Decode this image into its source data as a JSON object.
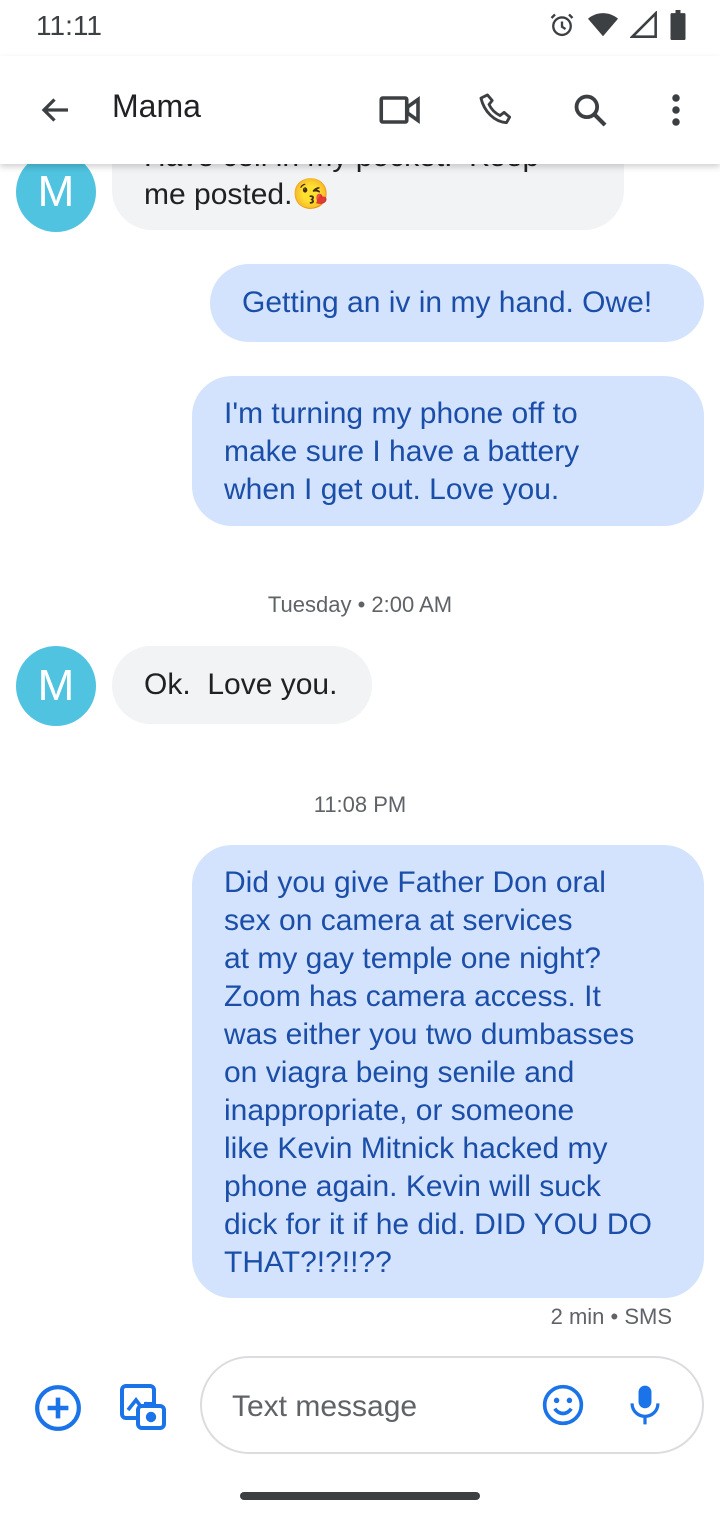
{
  "status_bar": {
    "time": "11:11"
  },
  "app_bar": {
    "title": "Mama"
  },
  "messages": [
    {
      "type": "in",
      "avatar_letter": "M",
      "text": "Have cell in my pocket.  Keep\nme posted.",
      "emoji": "😘"
    },
    {
      "type": "out",
      "text": "Getting an iv in my hand. Owe!"
    },
    {
      "type": "out",
      "text": "I'm turning my phone off to\nmake sure I have a battery\nwhen I get out. Love you."
    },
    {
      "type": "timestamp",
      "text": "Tuesday • 2:00 AM"
    },
    {
      "type": "in",
      "avatar_letter": "M",
      "text": "Ok.  Love you."
    },
    {
      "type": "timestamp",
      "text": "11:08 PM"
    },
    {
      "type": "out",
      "text": "Did you give Father Don oral\nsex on camera at services\nat my gay temple one night?\nZoom has camera access. It\nwas either you two dumbasses\non viagra being senile and\ninappropriate, or someone\nlike Kevin Mitnick hacked my\nphone again. Kevin will suck\ndick for it if he did. DID YOU DO\nTHAT?!?!!??"
    }
  ],
  "last_message_meta": "2 min • SMS",
  "compose": {
    "placeholder": "Text message"
  },
  "colors": {
    "accent": "#1a73e8",
    "avatar": "#4fc3e0",
    "incoming_bubble": "#f1f3f4",
    "outgoing_bubble": "#d3e3fd"
  }
}
